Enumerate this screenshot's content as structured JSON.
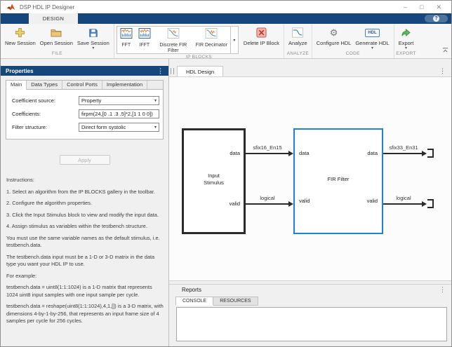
{
  "window": {
    "title": "DSP HDL IP Designer",
    "controls": {
      "minimize": "–",
      "maximize": "□",
      "close": "✕"
    }
  },
  "ribbon": {
    "design_tab": "DESIGN",
    "help_icon": "?"
  },
  "toolbar": {
    "file": {
      "label": "FILE",
      "new_session": "New Session",
      "open_session": "Open Session",
      "save_session": "Save Session"
    },
    "ip_blocks": {
      "label": "IP BLOCKS",
      "items": [
        {
          "label": "FFT"
        },
        {
          "label": "IFFT"
        },
        {
          "label": "Discrete FIR Filter"
        },
        {
          "label": "FIR Decimator"
        }
      ],
      "delete_button": "Delete IP Block"
    },
    "analyze": {
      "label": "ANALYZE",
      "button": "Analyze"
    },
    "code": {
      "label": "CODE",
      "configure_hdl": "Configure HDL",
      "generate_hdl": "Generate HDL",
      "hdl_badge": "HDL"
    },
    "export": {
      "label": "EXPORT",
      "button": "Export"
    }
  },
  "properties": {
    "title": "Properties",
    "tabs": [
      "Main",
      "Data Types",
      "Control Ports",
      "Implementation"
    ],
    "coefficient_source": {
      "label": "Coefficient source:",
      "value": "Property"
    },
    "coefficients": {
      "label": "Coefficients:",
      "value": "firpm(24,[0 .1 .3 .5]*2,[1 1 0 0])"
    },
    "filter_structure": {
      "label": "Filter structure:",
      "value": "Direct form systolic"
    },
    "apply_button": "Apply",
    "instructions": {
      "title": "Instructions:",
      "steps": [
        "1. Select an algorithm from the IP BLOCKS gallery in the toolbar.",
        "2. Configure the algorithm properties.",
        "3. Click the Input Stimulus block to view and modify the input data.",
        "4. Assign stimulus as variables within the testbench structure."
      ],
      "notes": [
        "You must use the same variable names as the default stimulus, i.e. testbench.data.",
        "The testbench.data input must be a 1-D or 3-D matrix in the data type you want your HDL IP to use.",
        "For example:",
        "testbench.data = uint8(1:1:1024) is a 1-D matrix that represents 1024 uint8 input samples with one input sample per cycle.",
        "testbench.data = reshape(uint8(1:1:1024),4,1,[]) is a 3-D matrix, with dimensions 4-by-1-by-256, that represents an input frame size of 4 samples per cycle for 256 cycles."
      ]
    }
  },
  "design": {
    "tab": "HDL Design",
    "input_stimulus": {
      "name": "Input\nStimulus",
      "out_ports": [
        "data",
        "valid"
      ]
    },
    "fir_filter": {
      "name": "FIR Filter",
      "in_ports": [
        "data",
        "valid"
      ],
      "out_ports": [
        "data",
        "valid"
      ]
    },
    "signals": {
      "data_in": "sfix16_En15",
      "valid_in": "logical",
      "data_out": "sfix33_En31",
      "valid_out": "logical"
    }
  },
  "reports": {
    "title": "Reports",
    "tabs": [
      "CONSOLE",
      "RESOURCES"
    ]
  },
  "icons": {
    "menu_dots": "⋮",
    "caret_down": "▾",
    "gear": "⚙"
  },
  "colors": {
    "ribbon_blue": "#16477C",
    "fir_block_border": "#1B83D8",
    "delete_red": "#C0564A",
    "export_green": "#4CAF50",
    "matlab_orange": "#D1501E"
  }
}
